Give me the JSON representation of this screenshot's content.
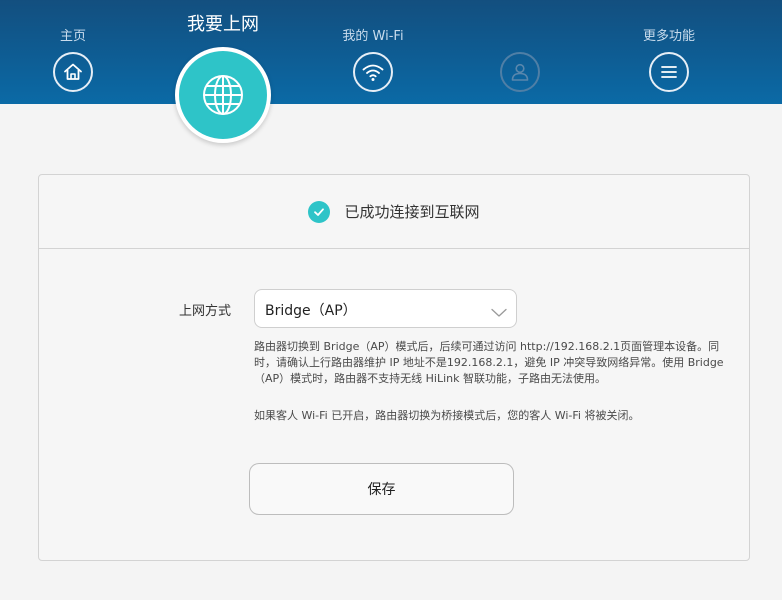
{
  "nav": {
    "home_label": "主页",
    "internet_label": "我要上网",
    "wifi_label": "我的 Wi-Fi",
    "user_label": "",
    "more_label": "更多功能"
  },
  "status": {
    "text": "已成功连接到互联网"
  },
  "form": {
    "mode_label": "上网方式",
    "mode_value": "Bridge（AP）",
    "description": "路由器切换到 Bridge（AP）模式后，后续可通过访问 http://192.168.2.1页面管理本设备。同时，请确认上行路由器维护 IP 地址不是192.168.2.1，避免 IP 冲突导致网络异常。使用 Bridge（AP）模式时，路由器不支持无线 HiLink 智联功能，子路由无法使用。",
    "guest_note": "如果客人 Wi-Fi 已开启，路由器切换为桥接模式后，您的客人 Wi-Fi 将被关闭。",
    "save_label": "保存"
  },
  "colors": {
    "header": "#0e5d94",
    "accent": "#2ec4c8",
    "card_border": "#d3d3d3"
  },
  "icons": [
    "home-icon",
    "globe-icon",
    "wifi-icon",
    "user-icon",
    "menu-icon",
    "check-icon",
    "chevron-down-icon"
  ]
}
